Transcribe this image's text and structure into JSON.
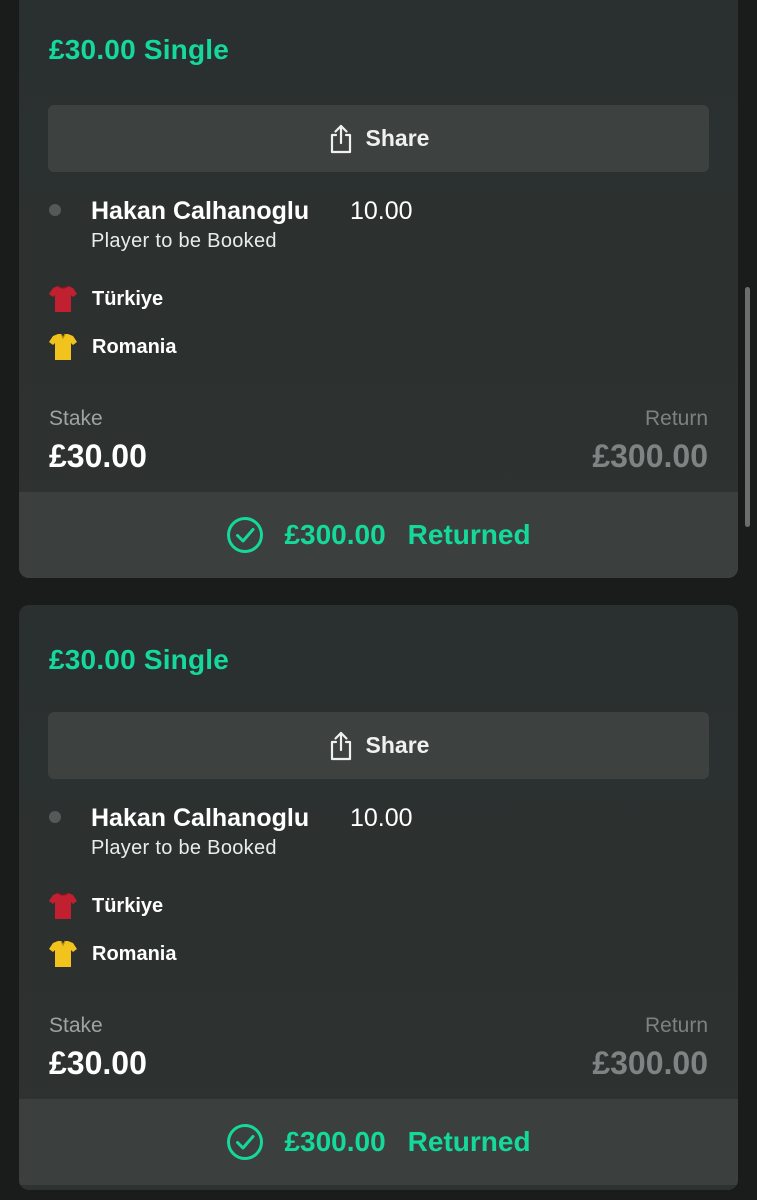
{
  "colors": {
    "accent": "#14d99a",
    "card_background": "#2c3130",
    "page_background": "#1a1c1c",
    "home_kit": "#c0202f",
    "away_kit": "#f2c31c"
  },
  "bets": [
    {
      "title": "£30.00 Single",
      "share_label": "Share",
      "selection": {
        "name": "Hakan Calhanoglu",
        "odds": "10.00",
        "market": "Player to be Booked"
      },
      "teams": [
        {
          "name": "Türkiye",
          "kit_icon": "red-shirt-icon"
        },
        {
          "name": "Romania",
          "kit_icon": "yellow-shirt-icon"
        }
      ],
      "stake_label": "Stake",
      "stake_value": "£30.00",
      "return_label": "Return",
      "return_value": "£300.00",
      "result_amount": "£300.00",
      "result_status": "Returned"
    },
    {
      "title": "£30.00 Single",
      "share_label": "Share",
      "selection": {
        "name": "Hakan Calhanoglu",
        "odds": "10.00",
        "market": "Player to be Booked"
      },
      "teams": [
        {
          "name": "Türkiye",
          "kit_icon": "red-shirt-icon"
        },
        {
          "name": "Romania",
          "kit_icon": "yellow-shirt-icon"
        }
      ],
      "stake_label": "Stake",
      "stake_value": "£30.00",
      "return_label": "Return",
      "return_value": "£300.00",
      "result_amount": "£300.00",
      "result_status": "Returned"
    }
  ]
}
